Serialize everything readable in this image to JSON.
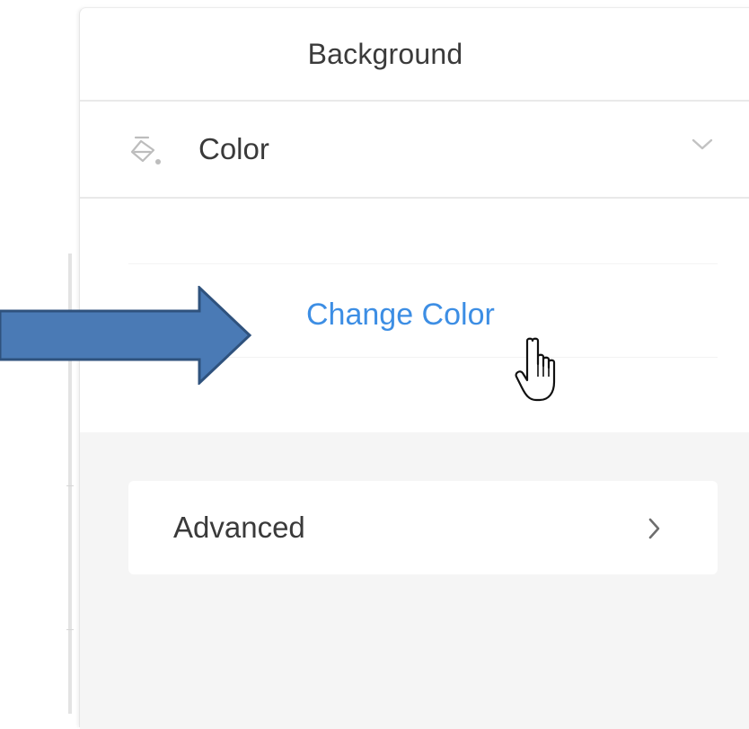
{
  "panel": {
    "title": "Background"
  },
  "section": {
    "label": "Color",
    "icon": "paint-bucket-icon",
    "expand_icon": "chevron-down-icon"
  },
  "content": {
    "change_color_label": "Change Color"
  },
  "advanced": {
    "label": "Advanced",
    "icon": "chevron-right-icon"
  },
  "annotation": {
    "arrow_color": "#4a7ab5",
    "arrow_stroke": "#2f527d"
  },
  "colors": {
    "link": "#3d8ee4",
    "text": "#3a3a3a",
    "divider": "#e9e9e9",
    "gray_bg": "#f5f5f5"
  }
}
